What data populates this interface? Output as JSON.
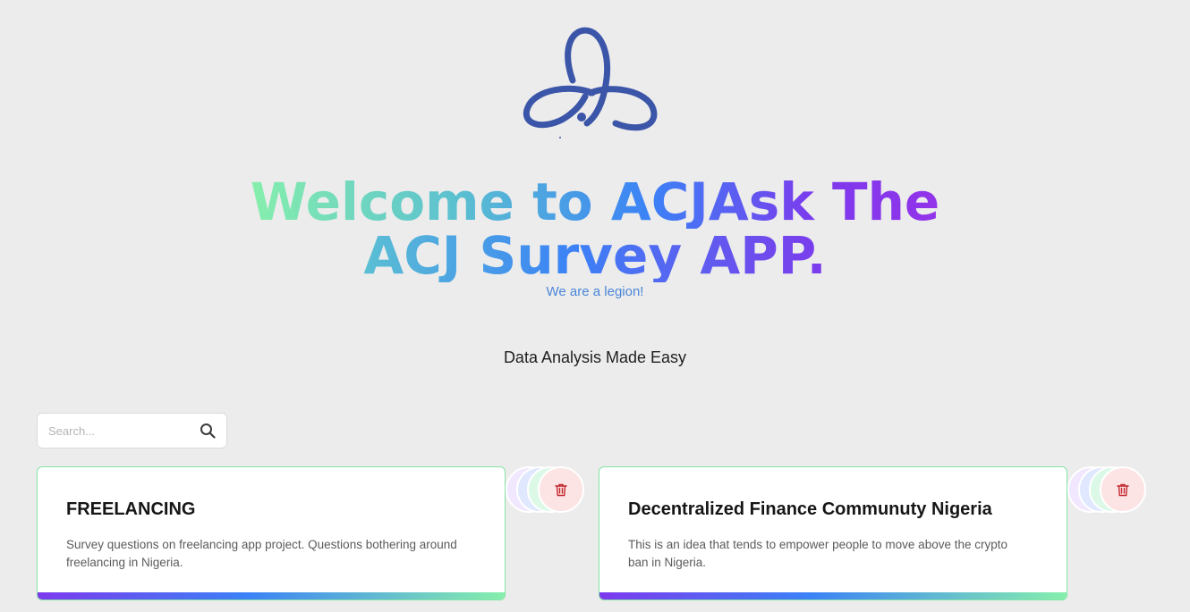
{
  "header": {
    "logo_icon": "acj-trefoil-logo",
    "headline_line1": "Welcome to ACJAsk The",
    "headline_line2": "ACJ Survey APP.",
    "tagline": "We are a legion!",
    "subtitle": "Data Analysis Made Easy"
  },
  "search": {
    "placeholder": "Search...",
    "value": "",
    "icon": "search-icon"
  },
  "surveys": [
    {
      "title": "FREELANCING",
      "description": "Survey questions on freelancing app project. Questions bothering around freelancing in Nigeria.",
      "delete_icon": "trash-icon"
    },
    {
      "title": "Decentralized Finance Communuty Nigeria",
      "description": "This is an idea that tends to empower people to move above the crypto ban in Nigeria.",
      "delete_icon": "trash-icon"
    }
  ],
  "colors": {
    "background": "#ececec",
    "logo": "#3b55a8",
    "tagline": "#4a86d8",
    "card_border": "#86e3a6",
    "gradient_start": "#7c3aed",
    "gradient_mid": "#3b82f6",
    "gradient_end": "#86efac",
    "delete": "#c0262d"
  }
}
